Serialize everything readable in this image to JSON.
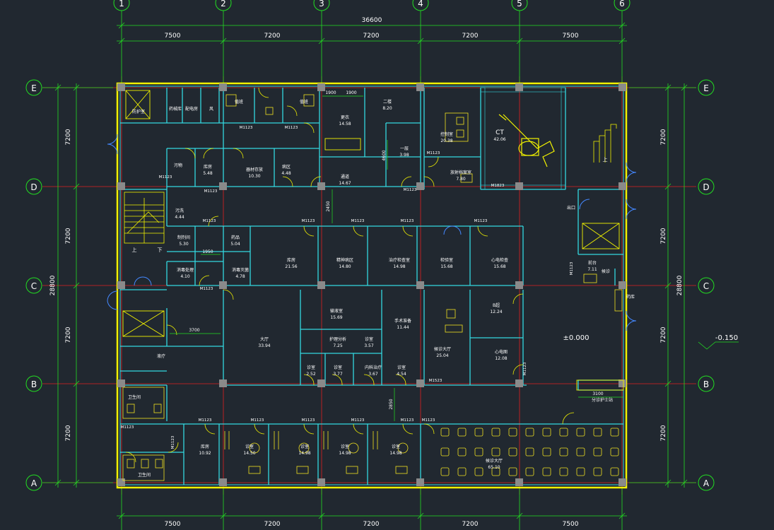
{
  "grid": {
    "columns": [
      "1",
      "2",
      "3",
      "4",
      "5",
      "6"
    ],
    "rows": [
      "E",
      "D",
      "C",
      "B",
      "A"
    ]
  },
  "dimensions": {
    "overall_width": "36600",
    "overall_height": "28800",
    "top_spans": [
      "7500",
      "7200",
      "7200",
      "7200",
      "7500"
    ],
    "bottom_spans": [
      "7500",
      "7200",
      "7200",
      "7200",
      "7500"
    ],
    "side_spans": [
      "7200",
      "7200",
      "7200",
      "7200"
    ]
  },
  "levels": {
    "floor": "±0.000",
    "outside": "-0.150"
  },
  "rooms": [
    {
      "name": "防护室",
      "area": ""
    },
    {
      "name": "药械库",
      "area": ""
    },
    {
      "name": "配电房",
      "area": ""
    },
    {
      "name": "风",
      "area": ""
    },
    {
      "name": "值班",
      "area": ""
    },
    {
      "name": "值班",
      "area": ""
    },
    {
      "name": "二楼",
      "area": "8.20"
    },
    {
      "name": "更衣",
      "area": "14.58"
    },
    {
      "name": "一层",
      "area": "3.98"
    },
    {
      "name": "控制室",
      "area": "20.38"
    },
    {
      "name": "CT",
      "area": "42.06"
    },
    {
      "name": "放射档案室",
      "area": "7.80"
    },
    {
      "name": "污物",
      "area": ""
    },
    {
      "name": "库房",
      "area": "5.48"
    },
    {
      "name": "器材存放",
      "area": "10.30"
    },
    {
      "name": "病区",
      "area": "4.48"
    },
    {
      "name": "通道",
      "area": "14.67"
    },
    {
      "name": "污洗",
      "area": "4.44"
    },
    {
      "name": "制剂间",
      "area": "5.30"
    },
    {
      "name": "药品",
      "area": "5.04"
    },
    {
      "name": "消毒处理",
      "area": "4.10"
    },
    {
      "name": "消毒灭菌",
      "area": "4.78"
    },
    {
      "name": "库房",
      "area": "21.56"
    },
    {
      "name": "精神病区",
      "area": "14.80"
    },
    {
      "name": "治疗检查室",
      "area": "14.98"
    },
    {
      "name": "检验室",
      "area": "15.68"
    },
    {
      "name": "心电检查",
      "area": "15.68"
    },
    {
      "name": "出口",
      "area": ""
    },
    {
      "name": "前台",
      "area": "7.11"
    },
    {
      "name": "候诊",
      "area": ""
    },
    {
      "name": "药库",
      "area": ""
    },
    {
      "name": "液疗",
      "area": ""
    },
    {
      "name": "大厅",
      "area": "33.94"
    },
    {
      "name": "输液室",
      "area": "15.69"
    },
    {
      "name": "手术准备",
      "area": "11.44"
    },
    {
      "name": "护理分析",
      "area": "7.25"
    },
    {
      "name": "诊室",
      "area": "3.57"
    },
    {
      "name": "诊室",
      "area": "2.52"
    },
    {
      "name": "诊室",
      "area": "3.77"
    },
    {
      "name": "内科治疗",
      "area": "3.67"
    },
    {
      "name": "诊室",
      "area": "4.54"
    },
    {
      "name": "候诊大厅",
      "area": "25.04"
    },
    {
      "name": "B超",
      "area": "12.24"
    },
    {
      "name": "心电图",
      "area": "12.08"
    },
    {
      "name": "卫生间",
      "area": ""
    },
    {
      "name": "卫生间",
      "area": ""
    },
    {
      "name": "库房",
      "area": "10.92"
    },
    {
      "name": "诊室",
      "area": "14.50"
    },
    {
      "name": "诊室",
      "area": "14.98"
    },
    {
      "name": "诊室",
      "area": "14.98"
    },
    {
      "name": "诊室",
      "area": "14.98"
    },
    {
      "name": "候诊大厅",
      "area": "65.10"
    },
    {
      "name": "分诊护士站",
      "area": ""
    }
  ],
  "labels": {
    "dim_1950": "1950",
    "dim_2450": "2450",
    "dim_3700": "3700",
    "dim_3100": "3100",
    "dim_2850": "2850",
    "dim_1900a": "1900",
    "dim_1900b": "1900",
    "dim_4600": "4600",
    "stair_up": "上",
    "stair_down": "下",
    "stair_up2": "上"
  },
  "door_tags": [
    "M1123",
    "M1123",
    "M1123",
    "M1123",
    "M1123",
    "M1123",
    "M1123",
    "M1123",
    "M1123",
    "M1123",
    "M1123",
    "M1123",
    "M1123",
    "M1123",
    "M1123",
    "M1123",
    "M1123",
    "M1123",
    "M1123",
    "M1123",
    "M1123",
    "M1123",
    "M1523",
    "M1823"
  ],
  "colors": {
    "background": "#212830",
    "grid_axis": "#e02020",
    "dimension": "#22dd22",
    "outer_wall": "#f2f200",
    "inner_wall": "#33d8e0",
    "text": "#ffffff",
    "door": "#4488ff",
    "column": "#8a8a8a",
    "fixture": "#f0e020"
  }
}
